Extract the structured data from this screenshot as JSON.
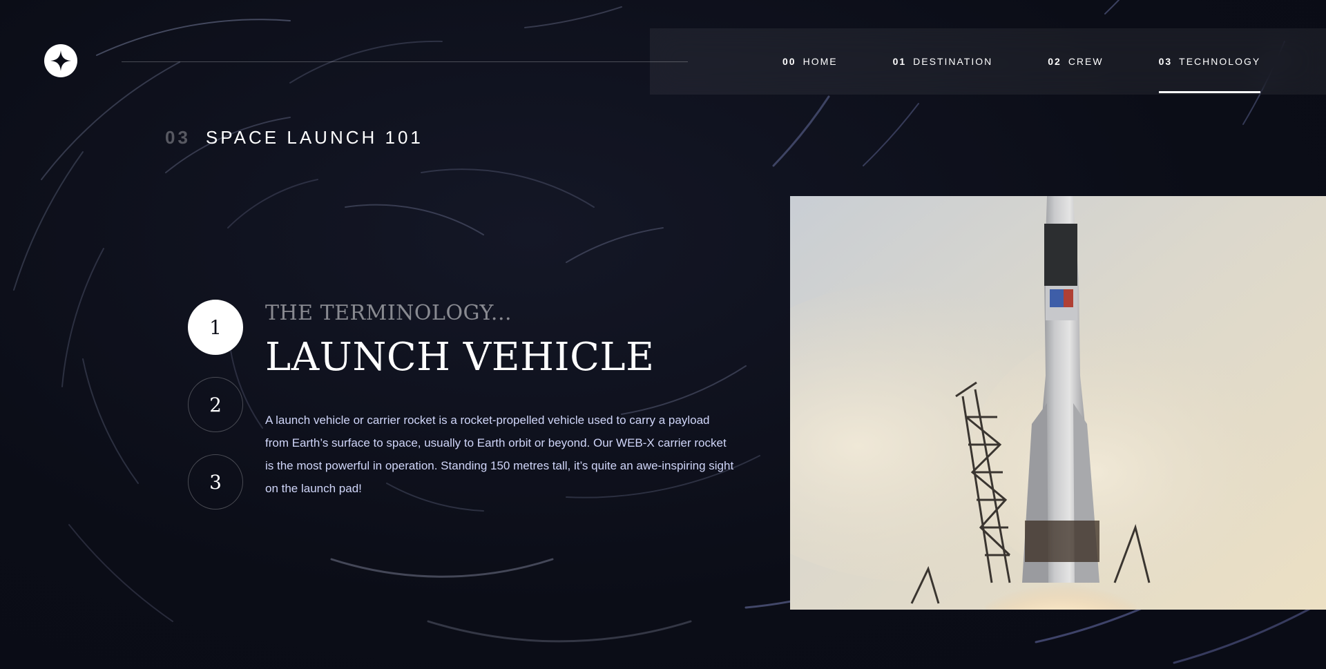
{
  "logo": {
    "icon": "star-logo-icon"
  },
  "nav": {
    "items": [
      {
        "num": "00",
        "label": "HOME",
        "active": false
      },
      {
        "num": "01",
        "label": "DESTINATION",
        "active": false
      },
      {
        "num": "02",
        "label": "CREW",
        "active": false
      },
      {
        "num": "03",
        "label": "TECHNOLOGY",
        "active": true
      }
    ]
  },
  "page_heading": {
    "num": "03",
    "text": "SPACE LAUNCH 101"
  },
  "steps": [
    {
      "label": "1",
      "active": true
    },
    {
      "label": "2",
      "active": false
    },
    {
      "label": "3",
      "active": false
    }
  ],
  "content": {
    "subheading": "THE TERMINOLOGY...",
    "title": "LAUNCH VEHICLE",
    "description": "A launch vehicle or carrier rocket is a rocket-propelled vehicle used to carry a payload from Earth’s surface to space, usually to Earth orbit or beyond. Our WEB-X carrier rocket is the most powerful in operation. Standing 150 metres tall, it’s quite an awe-inspiring sight on the launch pad!"
  },
  "image": {
    "subject": "rocket-launch-image"
  },
  "colors": {
    "background": "#0b0d17",
    "text": "#ffffff",
    "body_text": "#d0d6f9"
  }
}
